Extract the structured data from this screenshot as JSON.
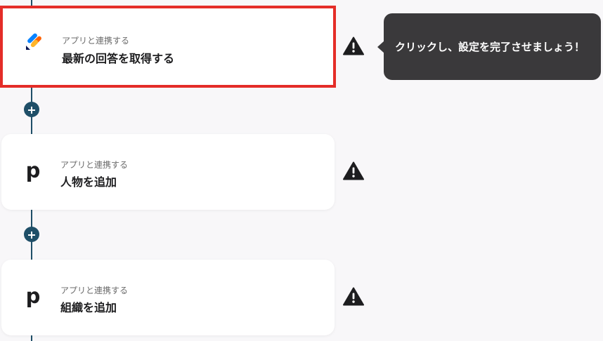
{
  "colors": {
    "flow_line": "#1f4f68",
    "selected_border": "#e42d28",
    "tooltip_bg": "#3a393b",
    "background": "#f8f7f9"
  },
  "tooltip": {
    "text": "クリックし、設定を完了させましょう！"
  },
  "steps": [
    {
      "icon": "jotform-logo-icon",
      "subtitle": "アプリと連携する",
      "title": "最新の回答を取得する",
      "warning_icon": "warning-icon",
      "selected": true
    },
    {
      "icon": "pipedrive-logo-icon",
      "logo_letter": "p",
      "subtitle": "アプリと連携する",
      "title": "人物を追加",
      "warning_icon": "warning-icon",
      "selected": false
    },
    {
      "icon": "pipedrive-logo-icon",
      "logo_letter": "p",
      "subtitle": "アプリと連携する",
      "title": "組織を追加",
      "warning_icon": "warning-icon",
      "selected": false
    }
  ],
  "add_buttons": [
    {
      "icon": "plus-icon"
    },
    {
      "icon": "plus-icon"
    }
  ]
}
